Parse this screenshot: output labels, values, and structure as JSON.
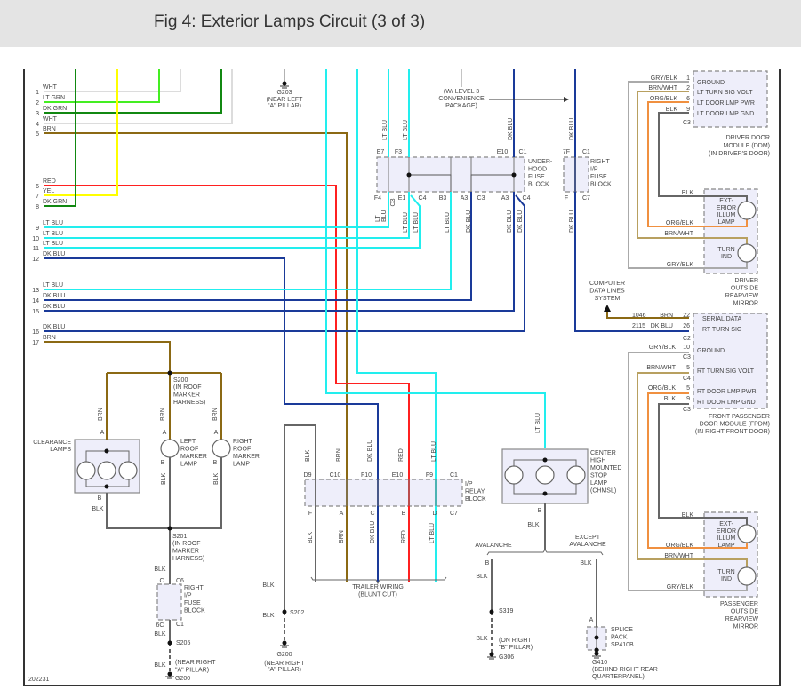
{
  "title": "Fig 4: Exterior Lamps Circuit (3 of 3)",
  "figure_id": "202231",
  "colors": {
    "WHT": "#dcdcdc",
    "LT GRN": "#44ee22",
    "DK GRN": "#118811",
    "YEL": "#ffff00",
    "RED": "#ff2020",
    "BRN": "#8b6914",
    "LT BLU": "#22eeee",
    "DK BLU": "#1a3a99",
    "BLK": "#666666",
    "GRY/BLK": "#aaaaaa",
    "BRN/WHT": "#b8a060",
    "ORG/BLK": "#f09040",
    "module_fill": "#eeeefa",
    "header_bg": "#e4e4e4"
  },
  "left_wires": [
    {
      "num": "1",
      "color": "WHT"
    },
    {
      "num": "2",
      "color": "LT GRN"
    },
    {
      "num": "3",
      "color": "DK GRN"
    },
    {
      "num": "4",
      "color": "WHT"
    },
    {
      "num": "5",
      "color": "BRN"
    },
    {
      "num": "6",
      "color": "RED"
    },
    {
      "num": "7",
      "color": "YEL"
    },
    {
      "num": "8",
      "color": "DK GRN"
    },
    {
      "num": "9",
      "color": "LT BLU"
    },
    {
      "num": "10",
      "color": "LT BLU"
    },
    {
      "num": "11",
      "color": "LT BLU"
    },
    {
      "num": "12",
      "color": "DK BLU"
    },
    {
      "num": "13",
      "color": "LT BLU"
    },
    {
      "num": "14",
      "color": "DK BLU"
    },
    {
      "num": "15",
      "color": "DK BLU"
    },
    {
      "num": "16",
      "color": "DK BLU"
    },
    {
      "num": "17",
      "color": "BRN"
    }
  ],
  "top": {
    "g203": "G203",
    "g203_loc": [
      "(NEAR LEFT",
      "\"A\" PILLAR)"
    ],
    "convenience": [
      "(W/ LEVEL 3",
      "CONVENIENCE",
      "PACKAGE)"
    ]
  },
  "underhood": {
    "name": [
      "UNDER-",
      "HOOD",
      "FUSE",
      "BLOCK"
    ],
    "top_pins": [
      "E7",
      "F3",
      "E10",
      "C1"
    ],
    "bottom_pins": [
      "F4",
      "C3",
      "E1",
      "C4",
      "B3",
      "A3",
      "C3",
      "A3",
      "C4"
    ],
    "wires_above": [
      "LT BLU",
      "LT BLU",
      "DK BLU"
    ],
    "wires_below": [
      "LT",
      "BLU",
      "LT BLU",
      "LT BLU",
      "LT BLU",
      "DK BLU",
      "DK BLU",
      "DK BLU"
    ]
  },
  "right_ip_fuse_top": {
    "name": [
      "RIGHT",
      "I/P",
      "FUSE",
      "BLOCK"
    ],
    "pins": [
      "7F",
      "C1",
      "F",
      "C7"
    ],
    "wires": [
      "DK BLU",
      "DK BLU"
    ]
  },
  "ddm": {
    "rows": [
      {
        "wire": "GRY/BLK",
        "pin": "1",
        "func": "GROUND"
      },
      {
        "wire": "BRN/WHT",
        "pin": "2",
        "func": "LT TURN SIG VOLT"
      },
      {
        "wire": "ORG/BLK",
        "pin": "6",
        "func": "LT DOOR LMP PWR"
      },
      {
        "wire": "BLK",
        "pin": "9",
        "func": "LT DOOR LMP GND"
      }
    ],
    "connector": "C3",
    "name": [
      "DRIVER DOOR",
      "MODULE (DDM)",
      "(IN DRIVER'S DOOR)"
    ]
  },
  "driver_mirror": {
    "lamp1": [
      "EXT-",
      "ERIOR",
      "ILLUM",
      "LAMP"
    ],
    "lamp2": [
      "TURN",
      "IND"
    ],
    "wires": [
      "BLK",
      "ORG/BLK",
      "BRN/WHT",
      "GRY/BLK"
    ],
    "name": [
      "DRIVER",
      "OUTSIDE",
      "REARVIEW",
      "MIRROR"
    ]
  },
  "computer_data": [
    "COMPUTER",
    "DATA LINES",
    "SYSTEM"
  ],
  "fpdm": {
    "data_rows": [
      {
        "circuit": "1046",
        "wire": "BRN",
        "pin": "22",
        "func": "SERIAL DATA"
      },
      {
        "circuit": "2115",
        "wire": "DK BLU",
        "pin": "26",
        "func": "RT TURN SIG"
      }
    ],
    "connectors": [
      "C2",
      "C3",
      "C4",
      "C3"
    ],
    "rows": [
      {
        "wire": "GRY/BLK",
        "pin": "10",
        "func": "GROUND"
      },
      {
        "wire": "BRN/WHT",
        "pin": "5",
        "func": "RT TURN SIG VOLT"
      },
      {
        "wire": "ORG/BLK",
        "pin": "5",
        "func": "RT DOOR LMP PWR"
      },
      {
        "wire": "BLK",
        "pin": "9",
        "func": "RT DOOR LMP GND"
      }
    ],
    "name": [
      "FRONT PASSENGER",
      "DOOR MODULE (FPDM)",
      "(IN RIGHT FRONT DOOR)"
    ]
  },
  "passenger_mirror": {
    "lamp1": [
      "EXT-",
      "ERIOR",
      "ILLUM",
      "LAMP"
    ],
    "lamp2": [
      "TURN",
      "IND"
    ],
    "wires": [
      "BLK",
      "ORG/BLK",
      "BRN/WHT",
      "GRY/BLK"
    ],
    "name": [
      "PASSENGER",
      "OUTSIDE",
      "REARVIEW",
      "MIRROR"
    ]
  },
  "roof": {
    "s200": "S200",
    "harness": [
      "(IN ROOF",
      "MARKER",
      "HARNESS)"
    ],
    "s201": "S201",
    "harness2": [
      "(IN ROOF",
      "MARKER",
      "HARNESS)"
    ],
    "brn": [
      "BRN",
      "BRN",
      "BRN"
    ],
    "pin_a": [
      "A",
      "A",
      "A"
    ],
    "pin_b": [
      "B",
      "B",
      "B"
    ],
    "blk": [
      "BLK",
      "BLK",
      "BLK"
    ],
    "clearance": [
      "CLEARANCE",
      "LAMPS"
    ],
    "left_marker": [
      "LEFT",
      "ROOF",
      "MARKER",
      "LAMP"
    ],
    "right_marker": [
      "RIGHT",
      "ROOF",
      "MARKER",
      "LAMP"
    ]
  },
  "lower_left": {
    "blk": [
      "BLK",
      "BLK",
      "BLK"
    ],
    "pin_c": "C",
    "c6": "C6",
    "fuse": [
      "RIGHT",
      "I/P",
      "FUSE",
      "BLOCK"
    ],
    "pin_6c": "6C",
    "c1": "C1",
    "s205": "S205",
    "loc": [
      "(NEAR RIGHT",
      "\"A\" PILLAR)"
    ],
    "g200": "G200"
  },
  "middle_ground": {
    "blk": [
      "BLK",
      "BLK"
    ],
    "s202": "S202",
    "g200": "G200",
    "loc": [
      "(NEAR RIGHT",
      "\"A\" PILLAR)"
    ]
  },
  "relay": {
    "wires_above": [
      "BLK",
      "BRN",
      "DK BLU",
      "RED",
      "LT BLU"
    ],
    "top_pins": [
      "D9",
      "C10",
      "F10",
      "E10",
      "F9",
      "C1"
    ],
    "name": [
      "I/P",
      "RELAY",
      "BLOCK"
    ],
    "bottom_pins": [
      "F",
      "A",
      "C",
      "B",
      "D",
      "C7"
    ],
    "wires_below": [
      "BLK",
      "BRN",
      "DK BLU",
      "RED",
      "LT BLU"
    ],
    "trailer": [
      "TRAILER WIRING",
      "(BLUNT CUT)"
    ]
  },
  "chmsl": {
    "wire_in": "LT BLU",
    "name": [
      "CENTER",
      "HIGH",
      "MOUNTED",
      "STOP",
      "LAMP",
      "(CHMSL)"
    ],
    "pin_b": "B",
    "blk": "BLK",
    "avalanche": "AVALANCHE",
    "except": [
      "EXCEPT",
      "AVALANCHE"
    ],
    "left_pin": "B",
    "left_blk": [
      "BLK",
      "BLK"
    ],
    "s319": "S319",
    "s319_loc": [
      "(ON RIGHT",
      "\"B\" PILLAR)"
    ],
    "g306": "G306",
    "right_blk": "BLK",
    "pin_a": "A",
    "splice": [
      "SPLICE",
      "PACK",
      "SP410B"
    ],
    "g410": "G410",
    "g410_loc": [
      "(BEHIND RIGHT REAR",
      "QUARTERPANEL)"
    ]
  }
}
